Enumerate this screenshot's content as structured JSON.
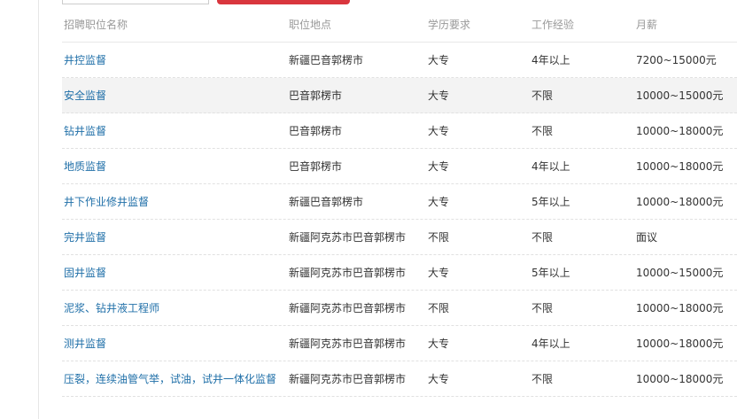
{
  "table": {
    "headers": [
      "招聘职位名称",
      "职位地点",
      "学历要求",
      "工作经验",
      "月薪"
    ],
    "rows": [
      {
        "title": "井控监督",
        "location": "新疆巴音郭楞市",
        "education": "大专",
        "experience": "4年以上",
        "salary": "7200~15000元"
      },
      {
        "title": "安全监督",
        "location": "巴音郭楞市",
        "education": "大专",
        "experience": "不限",
        "salary": "10000~15000元"
      },
      {
        "title": "钻井监督",
        "location": "巴音郭楞市",
        "education": "大专",
        "experience": "不限",
        "salary": "10000~18000元"
      },
      {
        "title": "地质监督",
        "location": "巴音郭楞市",
        "education": "大专",
        "experience": "4年以上",
        "salary": "10000~18000元"
      },
      {
        "title": "井下作业修井监督",
        "location": "新疆巴音郭楞市",
        "education": "大专",
        "experience": "5年以上",
        "salary": "10000~18000元"
      },
      {
        "title": "完井监督",
        "location": "新疆阿克苏市巴音郭楞市",
        "education": "不限",
        "experience": "不限",
        "salary": "面议"
      },
      {
        "title": "固井监督",
        "location": "新疆阿克苏市巴音郭楞市",
        "education": "大专",
        "experience": "5年以上",
        "salary": "10000~15000元"
      },
      {
        "title": "泥浆、钻井液工程师",
        "location": "新疆阿克苏市巴音郭楞市",
        "education": "不限",
        "experience": "不限",
        "salary": "10000~18000元"
      },
      {
        "title": "测井监督",
        "location": "新疆阿克苏市巴音郭楞市",
        "education": "大专",
        "experience": "4年以上",
        "salary": "10000~18000元"
      },
      {
        "title": "压裂，连续油管气举，试油，试井一体化监督",
        "location": "新疆阿克苏市巴音郭楞市",
        "education": "大专",
        "experience": "不限",
        "salary": "10000~18000元"
      }
    ]
  },
  "colors": {
    "link": "#1f6fa8",
    "header_text": "#999999",
    "highlight_row": "#f3f3f3",
    "button": "#d9363e"
  }
}
